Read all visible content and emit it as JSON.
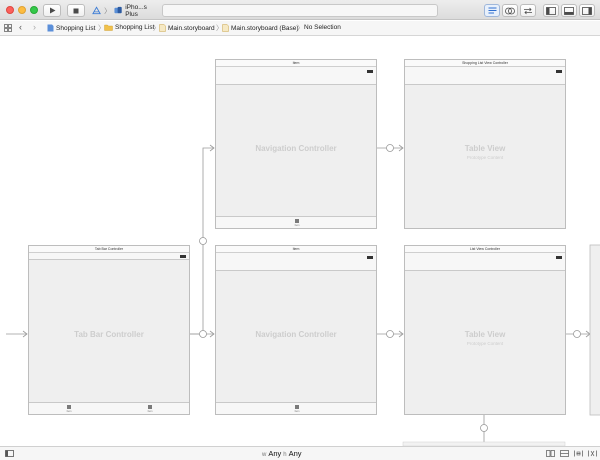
{
  "toolbar": {
    "scheme_target": "iPho...s Plus",
    "traffic_colors": {
      "close": "#fc605c",
      "minimize": "#fdbc40",
      "zoom": "#34c84a"
    }
  },
  "jumpbar": {
    "items": [
      "Shopping List",
      "Shopping List",
      "Main.storyboard",
      "Main.storyboard (Base)",
      "No Selection"
    ]
  },
  "canvas": {
    "scenes": {
      "nav_top": {
        "title": "Item",
        "placeholder": "Navigation Controller",
        "tab_label": "Item"
      },
      "table_top": {
        "title": "Shopping List View Controller",
        "placeholder": "Table View",
        "subtitle": "Prototype Content"
      },
      "tabbar": {
        "title": "Tab Bar Controller",
        "placeholder": "Tab Bar Controller",
        "tab1_label": "Item",
        "tab2_label": "Item"
      },
      "nav_bottom": {
        "title": "Item",
        "placeholder": "Navigation Controller",
        "tab_label": "Item"
      },
      "table_bottom": {
        "title": "List View Controller",
        "placeholder": "Table View",
        "subtitle": "Prototype Content"
      }
    }
  },
  "bottombar": {
    "w_prefix": "w",
    "w_value": "Any",
    "h_prefix": "h",
    "h_value": "Any"
  }
}
